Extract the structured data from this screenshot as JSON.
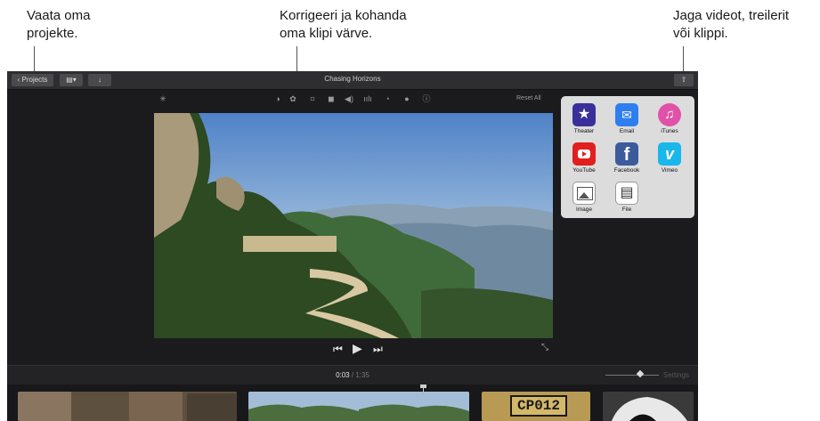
{
  "callouts": {
    "projects": [
      "Vaata oma",
      "projekte."
    ],
    "adjust": [
      "Korrigeeri ja kohanda",
      "oma klipi värve."
    ],
    "share": [
      "Jaga videot, treilerit",
      "või klippi."
    ]
  },
  "toolbar": {
    "projects_label": "Projects",
    "title": "Chasing Horizons"
  },
  "tools": {
    "reset_label": "Reset All"
  },
  "timeline": {
    "current": "0:03",
    "separator": "/",
    "total": "1:35",
    "settings_label": "Settings"
  },
  "share_menu": {
    "items": [
      {
        "label": "Theater",
        "icon": "star-icon",
        "color": "#3a2f9a"
      },
      {
        "label": "Email",
        "icon": "envelope-icon",
        "color": "#2f7ef0"
      },
      {
        "label": "iTunes",
        "icon": "music-note-icon",
        "color": "#e052a8"
      },
      {
        "label": "YouTube",
        "icon": "youtube-icon",
        "color": "#e11f1f"
      },
      {
        "label": "Facebook",
        "icon": "facebook-icon",
        "color": "#3b5b9c"
      },
      {
        "label": "Vimeo",
        "icon": "vimeo-icon",
        "color": "#1ab7ea"
      },
      {
        "label": "Image",
        "icon": "image-icon",
        "color": "#ffffff"
      },
      {
        "label": "File",
        "icon": "film-icon",
        "color": "#ffffff"
      }
    ]
  },
  "clip_text": "CP012"
}
